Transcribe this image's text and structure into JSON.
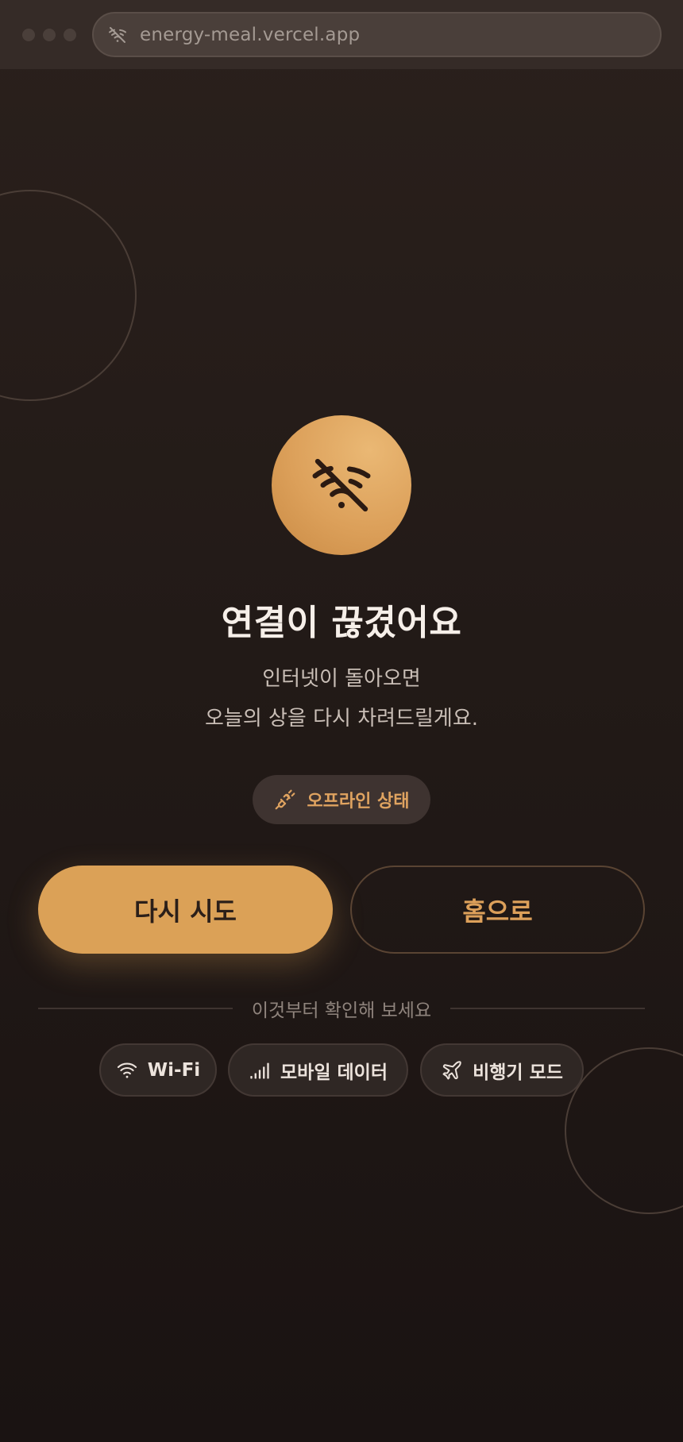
{
  "browser": {
    "url": "energy-meal.vercel.app",
    "url_icon": "wifi-off-icon"
  },
  "main": {
    "icon": "wifi-off-icon",
    "title": "연결이 끊겼어요",
    "subtitle_line1": "인터넷이 돌아오면",
    "subtitle_line2": "오늘의 상을 다시 차려드릴게요.",
    "status_badge": {
      "icon": "plug-icon",
      "label": "오프라인 상태"
    }
  },
  "actions": {
    "retry_label": "다시 시도",
    "home_label": "홈으로"
  },
  "tips": {
    "heading": "이것부터 확인해 보세요",
    "chips": [
      {
        "icon": "wifi-icon",
        "label": "Wi-Fi"
      },
      {
        "icon": "signal-bars-icon",
        "label": "모바일 데이터"
      },
      {
        "icon": "airplane-icon",
        "label": "비행기 모드"
      }
    ]
  },
  "colors": {
    "background": "#221a17",
    "accent": "#dba157",
    "text_primary": "#f6efe9",
    "text_secondary": "#c9beb6"
  }
}
